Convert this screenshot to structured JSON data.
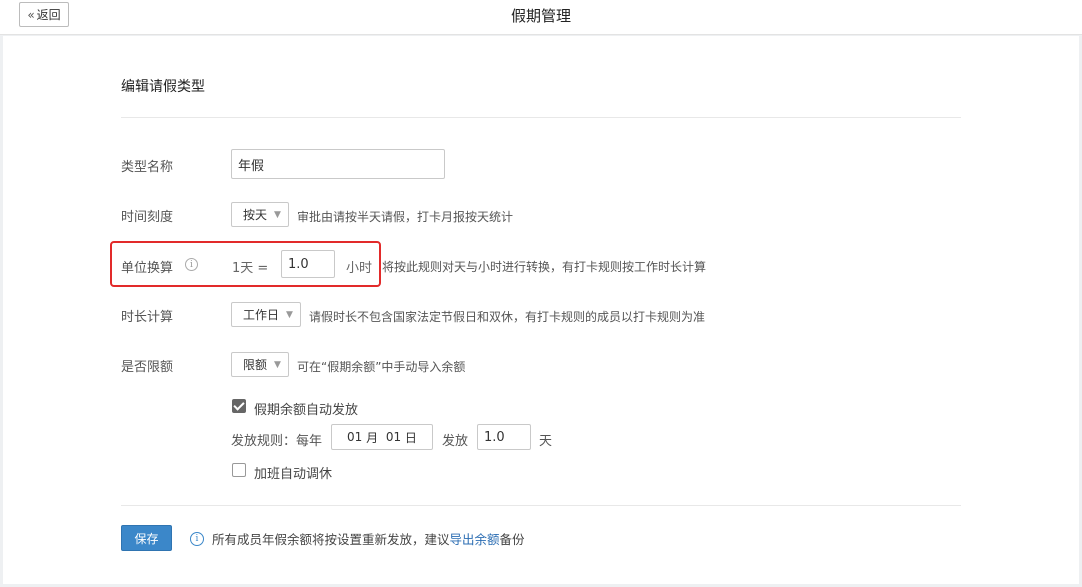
{
  "header": {
    "back_label": "返回",
    "title": "假期管理"
  },
  "form": {
    "section_title": "编辑请假类型",
    "type_name": {
      "label": "类型名称",
      "value": "年假"
    },
    "time_scale": {
      "label": "时间刻度",
      "selected": "按天",
      "hint": "审批由请按半天请假，打卡月报按天统计"
    },
    "unit_conversion": {
      "label": "单位换算",
      "prefix": "1天 =",
      "value": "1.0",
      "unit": "小时",
      "hint": "将按此规则对天与小时进行转换，有打卡规则按工作时长计算"
    },
    "duration_calc": {
      "label": "时长计算",
      "selected": "工作日",
      "hint": "请假时长不包含国家法定节假日和双休，有打卡规则的成员以打卡规则为准"
    },
    "quota": {
      "label": "是否限额",
      "selected": "限额",
      "hint": "可在“假期余额”中手动导入余额"
    },
    "auto_grant": {
      "label": "假期余额自动发放",
      "checked": true
    },
    "grant_rule": {
      "label": "发放规则：每年",
      "month": "01",
      "month_unit": "月",
      "day": "01",
      "day_unit": "日",
      "grant_label": "发放",
      "amount": "1.0",
      "amount_unit": "天"
    },
    "overtime_leave": {
      "label": "加班自动调休",
      "checked": false
    }
  },
  "footer": {
    "save_label": "保存",
    "info_text": "所有成员年假余额将按设置重新发放，建议",
    "export_link": "导出余额",
    "info_suffix": "备份"
  },
  "colors": {
    "primary": "#3b87c9",
    "highlight_border": "#e22a2a"
  }
}
